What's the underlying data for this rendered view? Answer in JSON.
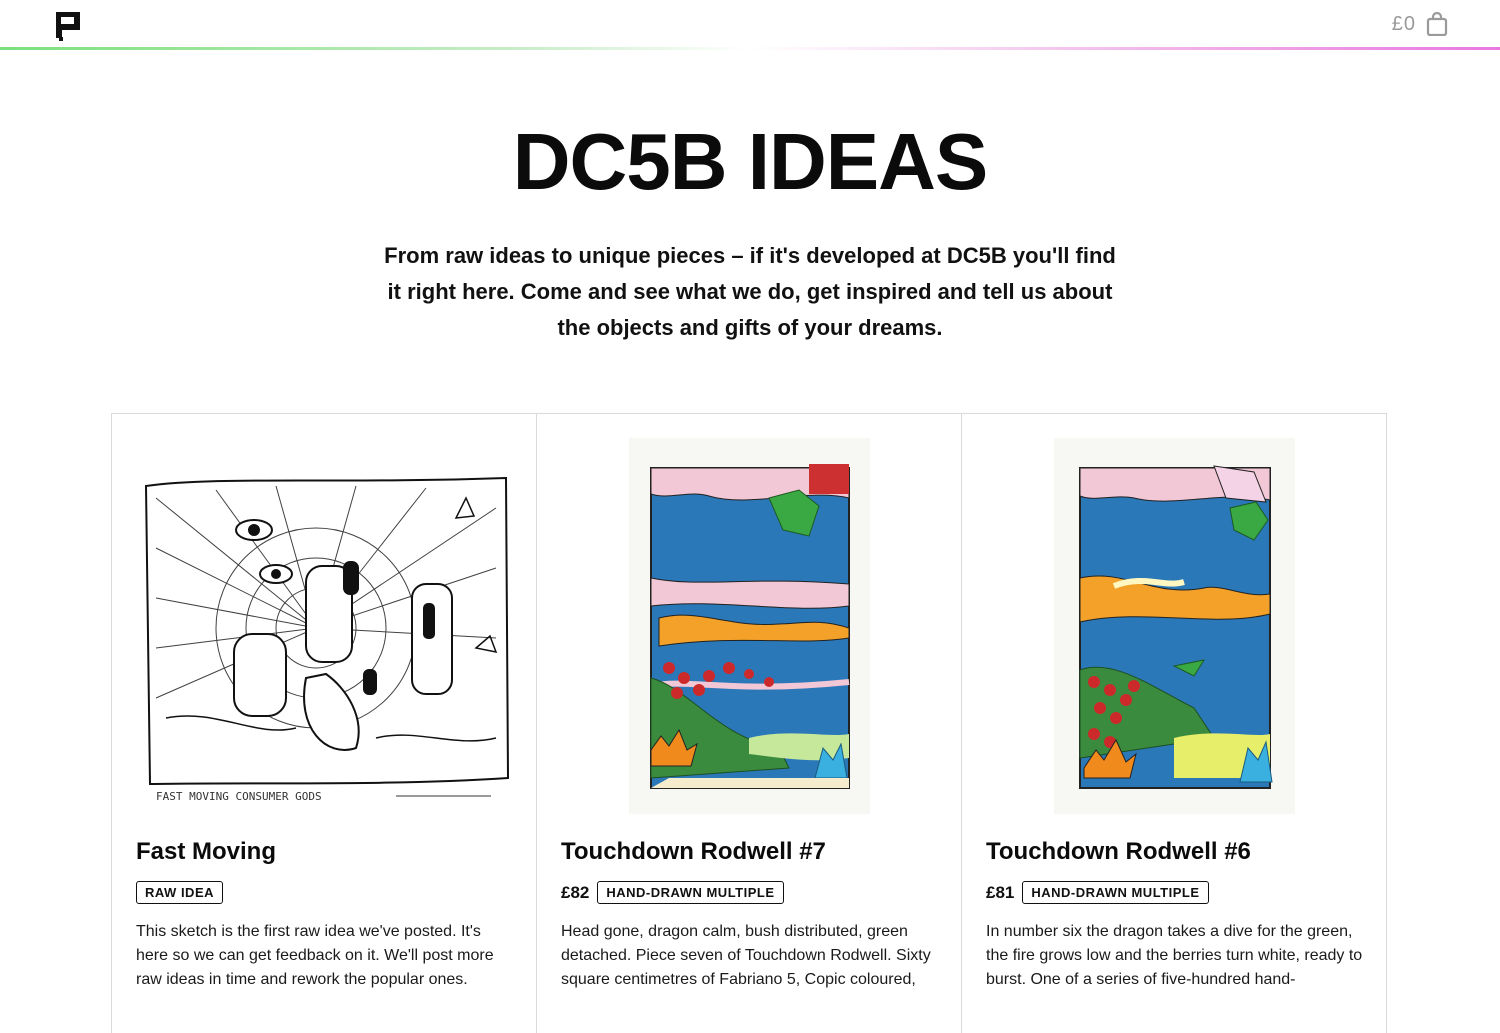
{
  "header": {
    "logo_icon": "dc5b-flag-logo-icon",
    "cart_total": "£0",
    "cart_icon": "shopping-bag-icon"
  },
  "hero": {
    "title": "DC5B IDEAS",
    "intro": "From raw ideas to unique pieces – if it's developed at DC5B you'll find it right here. Come and see what we do, get inspired and tell us about the objects and gifts of your dreams."
  },
  "products": [
    {
      "title": "Fast Moving",
      "price": "",
      "badge": "RAW IDEA",
      "description": "This sketch is the first raw idea we've posted. It's here so we can get feedback on it. We'll post more raw ideas in time and rework the popular ones.",
      "image_caption": "FAST MOVING CONSUMER GODS"
    },
    {
      "title": "Touchdown Rodwell #7",
      "price": "£82",
      "badge": "HAND-DRAWN MULTIPLE",
      "description": "Head gone, dragon calm, bush distributed, green detached. Piece seven of Touchdown Rodwell. Sixty square centimetres of Fabriano 5, Copic coloured,"
    },
    {
      "title": "Touchdown Rodwell #6",
      "price": "£81",
      "badge": "HAND-DRAWN MULTIPLE",
      "description": "In number six the dragon takes a dive for the green, the fire grows low and the berries turn white, ready to burst. One of a series of five-hundred hand-"
    }
  ]
}
